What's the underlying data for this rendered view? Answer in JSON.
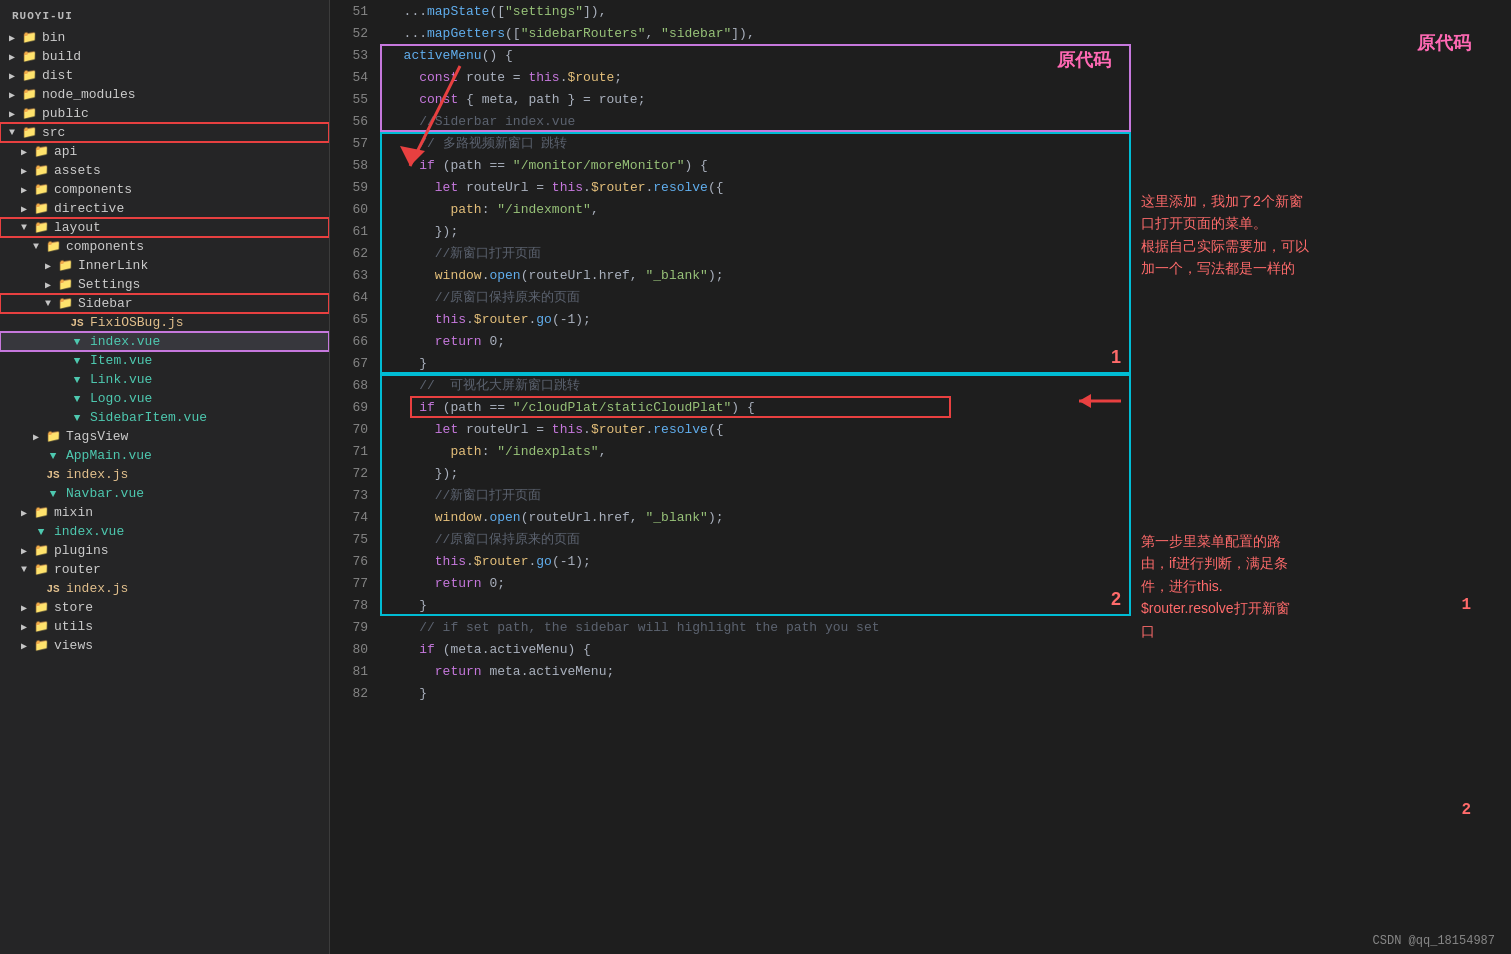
{
  "sidebar": {
    "title": "RUOYI-UI",
    "items": [
      {
        "id": "bin",
        "label": "bin",
        "type": "folder",
        "level": 0,
        "expanded": false
      },
      {
        "id": "build",
        "label": "build",
        "type": "folder",
        "level": 0,
        "expanded": false
      },
      {
        "id": "dist",
        "label": "dist",
        "type": "folder",
        "level": 0,
        "expanded": false
      },
      {
        "id": "node_modules",
        "label": "node_modules",
        "type": "folder",
        "level": 0,
        "expanded": false
      },
      {
        "id": "public",
        "label": "public",
        "type": "folder",
        "level": 0,
        "expanded": false
      },
      {
        "id": "src",
        "label": "src",
        "type": "folder",
        "level": 0,
        "expanded": true,
        "highlighted": true
      },
      {
        "id": "api",
        "label": "api",
        "type": "folder",
        "level": 1,
        "expanded": false
      },
      {
        "id": "assets",
        "label": "assets",
        "type": "folder",
        "level": 1,
        "expanded": false
      },
      {
        "id": "components",
        "label": "components",
        "type": "folder",
        "level": 1,
        "expanded": false
      },
      {
        "id": "directive",
        "label": "directive",
        "type": "folder",
        "level": 1,
        "expanded": false
      },
      {
        "id": "layout",
        "label": "layout",
        "type": "folder",
        "level": 1,
        "expanded": true,
        "border": "red"
      },
      {
        "id": "components2",
        "label": "components",
        "type": "folder",
        "level": 2,
        "expanded": true
      },
      {
        "id": "InnerLink",
        "label": "InnerLink",
        "type": "folder",
        "level": 3,
        "expanded": false
      },
      {
        "id": "Settings",
        "label": "Settings",
        "type": "folder",
        "level": 3,
        "expanded": false
      },
      {
        "id": "Sidebar",
        "label": "Sidebar",
        "type": "folder",
        "level": 3,
        "expanded": true,
        "border": "red"
      },
      {
        "id": "FixiOSBug",
        "label": "FixiOSBug.js",
        "type": "js",
        "level": 4
      },
      {
        "id": "index_vue",
        "label": "index.vue",
        "type": "vue",
        "level": 4,
        "selected": true
      },
      {
        "id": "Item_vue",
        "label": "Item.vue",
        "type": "vue",
        "level": 4
      },
      {
        "id": "Link_vue",
        "label": "Link.vue",
        "type": "vue",
        "level": 4
      },
      {
        "id": "Logo_vue",
        "label": "Logo.vue",
        "type": "vue",
        "level": 4
      },
      {
        "id": "SidebarItem_vue",
        "label": "SidebarItem.vue",
        "type": "vue",
        "level": 4
      },
      {
        "id": "TagsView",
        "label": "TagsView",
        "type": "folder",
        "level": 2,
        "expanded": false
      },
      {
        "id": "AppMain_vue",
        "label": "AppMain.vue",
        "type": "vue",
        "level": 2
      },
      {
        "id": "index_js2",
        "label": "index.js",
        "type": "js",
        "level": 2
      },
      {
        "id": "Navbar_vue",
        "label": "Navbar.vue",
        "type": "vue",
        "level": 2
      },
      {
        "id": "mixin",
        "label": "mixin",
        "type": "folder",
        "level": 1,
        "expanded": false
      },
      {
        "id": "index_vue2",
        "label": "index.vue",
        "type": "vue",
        "level": 1
      },
      {
        "id": "plugins",
        "label": "plugins",
        "type": "folder",
        "level": 1,
        "expanded": false
      },
      {
        "id": "router",
        "label": "router",
        "type": "folder",
        "level": 1,
        "expanded": true
      },
      {
        "id": "index_js3",
        "label": "index.js",
        "type": "js",
        "level": 2
      },
      {
        "id": "store",
        "label": "store",
        "type": "folder",
        "level": 1,
        "expanded": false
      },
      {
        "id": "utils",
        "label": "utils",
        "type": "folder",
        "level": 1,
        "expanded": false
      },
      {
        "id": "views",
        "label": "views",
        "type": "folder",
        "level": 1,
        "expanded": false
      }
    ]
  },
  "code": {
    "lines": [
      {
        "num": 51,
        "tokens": [
          {
            "text": "  ...",
            "cls": "white"
          },
          {
            "text": "mapState",
            "cls": "fn"
          },
          {
            "text": "([",
            "cls": "white"
          },
          {
            "text": "\"settings\"",
            "cls": "str"
          },
          {
            "text": "]),",
            "cls": "white"
          }
        ]
      },
      {
        "num": 52,
        "tokens": [
          {
            "text": "  ...",
            "cls": "white"
          },
          {
            "text": "mapGetters",
            "cls": "fn"
          },
          {
            "text": "([",
            "cls": "white"
          },
          {
            "text": "\"sidebarRouters\"",
            "cls": "str"
          },
          {
            "text": ", ",
            "cls": "white"
          },
          {
            "text": "\"sidebar\"",
            "cls": "str"
          },
          {
            "text": "]),",
            "cls": "white"
          }
        ]
      },
      {
        "num": 53,
        "tokens": [
          {
            "text": "  ",
            "cls": "white"
          },
          {
            "text": "activeMenu",
            "cls": "fn"
          },
          {
            "text": "() {",
            "cls": "white"
          }
        ]
      },
      {
        "num": 54,
        "tokens": [
          {
            "text": "    ",
            "cls": "white"
          },
          {
            "text": "const",
            "cls": "kw"
          },
          {
            "text": " route = ",
            "cls": "white"
          },
          {
            "text": "this",
            "cls": "kw"
          },
          {
            "text": ".",
            "cls": "white"
          },
          {
            "text": "$route",
            "cls": "prop"
          },
          {
            "text": ";",
            "cls": "white"
          }
        ]
      },
      {
        "num": 55,
        "tokens": [
          {
            "text": "    ",
            "cls": "white"
          },
          {
            "text": "const",
            "cls": "kw"
          },
          {
            "text": " { meta, path } = route;",
            "cls": "white"
          }
        ]
      },
      {
        "num": 56,
        "tokens": [
          {
            "text": "    ",
            "cls": "white"
          },
          {
            "text": "//Siderbar index.vue",
            "cls": "comment"
          }
        ]
      },
      {
        "num": 57,
        "tokens": [
          {
            "text": "    ",
            "cls": "white"
          },
          {
            "text": "// 多路视频新窗口 跳转",
            "cls": "comment"
          }
        ]
      },
      {
        "num": 58,
        "tokens": [
          {
            "text": "    ",
            "cls": "white"
          },
          {
            "text": "if",
            "cls": "kw"
          },
          {
            "text": " (path == ",
            "cls": "white"
          },
          {
            "text": "\"/monitor/moreMonitor\"",
            "cls": "str"
          },
          {
            "text": ") {",
            "cls": "white"
          }
        ]
      },
      {
        "num": 59,
        "tokens": [
          {
            "text": "      ",
            "cls": "white"
          },
          {
            "text": "let",
            "cls": "kw"
          },
          {
            "text": " routeUrl = ",
            "cls": "white"
          },
          {
            "text": "this",
            "cls": "kw"
          },
          {
            "text": ".",
            "cls": "white"
          },
          {
            "text": "$router",
            "cls": "prop"
          },
          {
            "text": ".",
            "cls": "white"
          },
          {
            "text": "resolve",
            "cls": "fn"
          },
          {
            "text": "({",
            "cls": "white"
          }
        ]
      },
      {
        "num": 60,
        "tokens": [
          {
            "text": "        ",
            "cls": "white"
          },
          {
            "text": "path",
            "cls": "prop"
          },
          {
            "text": ": ",
            "cls": "white"
          },
          {
            "text": "\"/indexmont\"",
            "cls": "str"
          },
          {
            "text": ",",
            "cls": "white"
          }
        ]
      },
      {
        "num": 61,
        "tokens": [
          {
            "text": "      ",
            "cls": "white"
          },
          {
            "text": "});",
            "cls": "white"
          }
        ]
      },
      {
        "num": 62,
        "tokens": [
          {
            "text": "      ",
            "cls": "white"
          },
          {
            "text": "//新窗口打开页面",
            "cls": "comment"
          }
        ]
      },
      {
        "num": 63,
        "tokens": [
          {
            "text": "      ",
            "cls": "white"
          },
          {
            "text": "window",
            "cls": "prop"
          },
          {
            "text": ".",
            "cls": "white"
          },
          {
            "text": "open",
            "cls": "fn"
          },
          {
            "text": "(routeUrl.href, ",
            "cls": "white"
          },
          {
            "text": "\"_blank\"",
            "cls": "str"
          },
          {
            "text": ");",
            "cls": "white"
          }
        ]
      },
      {
        "num": 64,
        "tokens": [
          {
            "text": "      ",
            "cls": "white"
          },
          {
            "text": "//原窗口保持原来的页面",
            "cls": "comment"
          }
        ]
      },
      {
        "num": 65,
        "tokens": [
          {
            "text": "      ",
            "cls": "white"
          },
          {
            "text": "this",
            "cls": "kw"
          },
          {
            "text": ".",
            "cls": "white"
          },
          {
            "text": "$router",
            "cls": "prop"
          },
          {
            "text": ".",
            "cls": "white"
          },
          {
            "text": "go",
            "cls": "fn"
          },
          {
            "text": "(-1);",
            "cls": "white"
          }
        ]
      },
      {
        "num": 66,
        "tokens": [
          {
            "text": "      ",
            "cls": "white"
          },
          {
            "text": "return",
            "cls": "kw"
          },
          {
            "text": " 0;",
            "cls": "white"
          }
        ]
      },
      {
        "num": 67,
        "tokens": [
          {
            "text": "    ",
            "cls": "white"
          },
          {
            "text": "}",
            "cls": "white"
          }
        ]
      },
      {
        "num": 68,
        "tokens": [
          {
            "text": "    ",
            "cls": "white"
          },
          {
            "text": "//  可视化大屏新窗口跳转",
            "cls": "comment"
          }
        ]
      },
      {
        "num": 69,
        "tokens": [
          {
            "text": "    ",
            "cls": "white"
          },
          {
            "text": "if",
            "cls": "kw"
          },
          {
            "text": " (path == ",
            "cls": "white"
          },
          {
            "text": "\"/cloudPlat/staticCloudPlat\"",
            "cls": "str"
          },
          {
            "text": ") {",
            "cls": "white"
          }
        ]
      },
      {
        "num": 70,
        "tokens": [
          {
            "text": "      ",
            "cls": "white"
          },
          {
            "text": "let",
            "cls": "kw"
          },
          {
            "text": " routeUrl = ",
            "cls": "white"
          },
          {
            "text": "this",
            "cls": "kw"
          },
          {
            "text": ".",
            "cls": "white"
          },
          {
            "text": "$router",
            "cls": "prop"
          },
          {
            "text": ".",
            "cls": "white"
          },
          {
            "text": "resolve",
            "cls": "fn"
          },
          {
            "text": "({",
            "cls": "white"
          }
        ]
      },
      {
        "num": 71,
        "tokens": [
          {
            "text": "        ",
            "cls": "white"
          },
          {
            "text": "path",
            "cls": "prop"
          },
          {
            "text": ": ",
            "cls": "white"
          },
          {
            "text": "\"/indexplats\"",
            "cls": "str"
          },
          {
            "text": ",",
            "cls": "white"
          }
        ]
      },
      {
        "num": 72,
        "tokens": [
          {
            "text": "      ",
            "cls": "white"
          },
          {
            "text": "});",
            "cls": "white"
          }
        ]
      },
      {
        "num": 73,
        "tokens": [
          {
            "text": "      ",
            "cls": "white"
          },
          {
            "text": "//新窗口打开页面",
            "cls": "comment"
          }
        ]
      },
      {
        "num": 74,
        "tokens": [
          {
            "text": "      ",
            "cls": "white"
          },
          {
            "text": "window",
            "cls": "prop"
          },
          {
            "text": ".",
            "cls": "white"
          },
          {
            "text": "open",
            "cls": "fn"
          },
          {
            "text": "(routeUrl.href, ",
            "cls": "white"
          },
          {
            "text": "\"_blank\"",
            "cls": "str"
          },
          {
            "text": ");",
            "cls": "white"
          }
        ]
      },
      {
        "num": 75,
        "tokens": [
          {
            "text": "      ",
            "cls": "white"
          },
          {
            "text": "//原窗口保持原来的页面",
            "cls": "comment"
          }
        ]
      },
      {
        "num": 76,
        "tokens": [
          {
            "text": "      ",
            "cls": "white"
          },
          {
            "text": "this",
            "cls": "kw"
          },
          {
            "text": ".",
            "cls": "white"
          },
          {
            "text": "$router",
            "cls": "prop"
          },
          {
            "text": ".",
            "cls": "white"
          },
          {
            "text": "go",
            "cls": "fn"
          },
          {
            "text": "(-1);",
            "cls": "white"
          }
        ]
      },
      {
        "num": 77,
        "tokens": [
          {
            "text": "      ",
            "cls": "white"
          },
          {
            "text": "return",
            "cls": "kw"
          },
          {
            "text": " 0;",
            "cls": "white"
          }
        ]
      },
      {
        "num": 78,
        "tokens": [
          {
            "text": "    ",
            "cls": "white"
          },
          {
            "text": "}",
            "cls": "white"
          }
        ]
      },
      {
        "num": 79,
        "tokens": [
          {
            "text": "    ",
            "cls": "white"
          },
          {
            "text": "// if set path, the sidebar will highlight the path you set",
            "cls": "comment"
          }
        ]
      },
      {
        "num": 80,
        "tokens": [
          {
            "text": "    ",
            "cls": "white"
          },
          {
            "text": "if",
            "cls": "kw"
          },
          {
            "text": " (meta.activeMenu) {",
            "cls": "white"
          }
        ]
      },
      {
        "num": 81,
        "tokens": [
          {
            "text": "      ",
            "cls": "white"
          },
          {
            "text": "return",
            "cls": "kw"
          },
          {
            "text": " meta.activeMenu;",
            "cls": "white"
          }
        ]
      },
      {
        "num": 82,
        "tokens": [
          {
            "text": "    ",
            "cls": "white"
          },
          {
            "text": "}",
            "cls": "white"
          }
        ]
      }
    ]
  },
  "annotations": {
    "label1": "原代码",
    "label2": "1",
    "label3": "2",
    "text1": "这里添加，我加了2个新窗\n口打开页面的菜单。\n根据自己实际需要加，可以\n加一个，写法都是一样的",
    "text2": "第一步里菜单配置的路\n由，if进行判断，满足条\n件，进行this.\n$router.resolve打开新窗\n口"
  },
  "footer": {
    "credit": "CSDN @qq_18154987"
  }
}
